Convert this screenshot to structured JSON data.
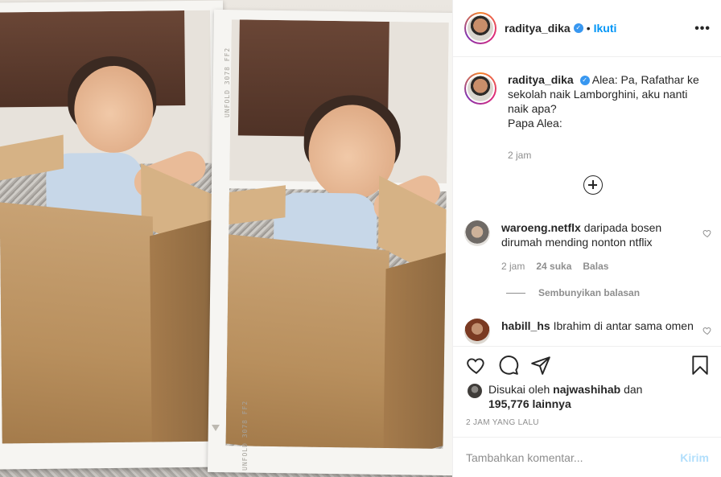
{
  "post": {
    "author": "raditya_dika",
    "follow_label": "Ikuti",
    "separator": "•",
    "more_label": "•••"
  },
  "caption": {
    "author": "raditya_dika",
    "text": "Alea: Pa, Rafathar ke sekolah naik Lamborghini, aku nanti naik apa?\nPapa Alea:",
    "time": "2 jam"
  },
  "comments": [
    {
      "author": "waroeng.netflx",
      "text": "daripada bosen dirumah mending nonton ntflix",
      "time": "2 jam",
      "likes": "24 suka",
      "reply_label": "Balas"
    },
    {
      "author": "habill_hs",
      "text": "Ibrahim di antar sama omen"
    }
  ],
  "hide_replies_label": "Sembunyikan balasan",
  "photo": {
    "tape_text_left": "UNFOLD 3078 FF2",
    "tape_text_right": "UNFOLD 3078 FF2"
  },
  "likes": {
    "prefix": "Disukai oleh",
    "user": "najwashihab",
    "conjunction": "dan",
    "count": "195,776 lainnya"
  },
  "time_ago": "2 JAM YANG LALU",
  "add_comment": {
    "placeholder": "Tambahkan komentar...",
    "post_label": "Kirim"
  },
  "colors": {
    "accent": "#0095f6",
    "verified": "#3897f0",
    "muted": "#8e8e8e",
    "post_disabled": "#b2dffc"
  },
  "icons": [
    "heart-icon",
    "comment-icon",
    "share-icon",
    "bookmark-icon",
    "add-circle-icon",
    "more-icon",
    "verified-icon"
  ]
}
